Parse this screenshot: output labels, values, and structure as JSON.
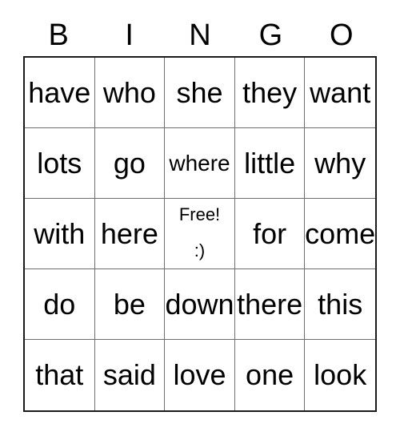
{
  "card": {
    "title": "BINGO",
    "header_letters": [
      "B",
      "I",
      "N",
      "G",
      "O"
    ],
    "grid_size": "5x5",
    "rows": [
      [
        {
          "text": "have",
          "fit": "normal"
        },
        {
          "text": "who",
          "fit": "normal"
        },
        {
          "text": "she",
          "fit": "normal"
        },
        {
          "text": "they",
          "fit": "normal"
        },
        {
          "text": "want",
          "fit": "normal"
        }
      ],
      [
        {
          "text": "lots",
          "fit": "normal"
        },
        {
          "text": "go",
          "fit": "normal"
        },
        {
          "text": "where",
          "fit": "small"
        },
        {
          "text": "little",
          "fit": "normal"
        },
        {
          "text": "why",
          "fit": "normal"
        }
      ],
      [
        {
          "text": "with",
          "fit": "normal"
        },
        {
          "text": "here",
          "fit": "normal"
        },
        {
          "free": true,
          "line1": "Free!",
          "line2": ":)"
        },
        {
          "text": "for",
          "fit": "normal"
        },
        {
          "text": "come",
          "fit": "normal"
        }
      ],
      [
        {
          "text": "do",
          "fit": "normal"
        },
        {
          "text": "be",
          "fit": "normal"
        },
        {
          "text": "down",
          "fit": "normal"
        },
        {
          "text": "there",
          "fit": "normal"
        },
        {
          "text": "this",
          "fit": "normal"
        }
      ],
      [
        {
          "text": "that",
          "fit": "normal"
        },
        {
          "text": "said",
          "fit": "normal"
        },
        {
          "text": "love",
          "fit": "normal"
        },
        {
          "text": "one",
          "fit": "normal"
        },
        {
          "text": "look",
          "fit": "normal"
        }
      ]
    ],
    "colors": {
      "background": "#ffffff",
      "text": "#000000",
      "outer_border": "#1a1a1a",
      "inner_grid_line": "#6e6e6e"
    }
  }
}
